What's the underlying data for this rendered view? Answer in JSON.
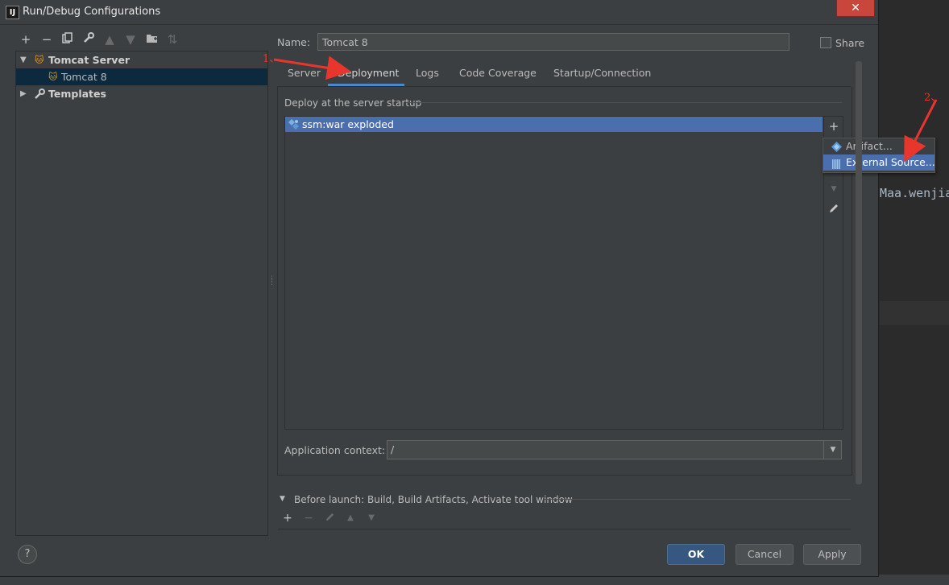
{
  "window": {
    "title": "Run/Debug Configurations",
    "app_icon": "IJ",
    "close_glyph": "✕"
  },
  "background": {
    "code_text": "Maa.wenjia"
  },
  "left_toolbar": {
    "icons": [
      "add-icon",
      "remove-icon",
      "copy-icon",
      "wrench-icon",
      "move-up-icon",
      "move-down-icon",
      "folder-icon",
      "sort-icon"
    ]
  },
  "tree": {
    "items": [
      {
        "label": "Tomcat Server",
        "level": 0,
        "expanded": true
      },
      {
        "label": "Tomcat 8",
        "level": 1,
        "selected": true
      },
      {
        "label": "Templates",
        "level": 0,
        "expanded": false
      }
    ]
  },
  "config": {
    "name_label": "Name:",
    "name_value": "Tomcat 8",
    "share_label": "Share",
    "share_checked": false
  },
  "tabs": [
    {
      "label": "Server"
    },
    {
      "label": "Deployment",
      "active": true
    },
    {
      "label": "Logs"
    },
    {
      "label": "Code Coverage"
    },
    {
      "label": "Startup/Connection"
    }
  ],
  "deployment": {
    "section_title": "Deploy at the server startup",
    "items": [
      "ssm:war exploded"
    ],
    "add_button": "+",
    "popup_items": [
      {
        "label": "Artifact..."
      },
      {
        "label": "External Source...",
        "selected": true
      }
    ],
    "context_label": "Application context:",
    "context_value": "/"
  },
  "before_launch": {
    "label": "Before launch: Build, Build Artifacts, Activate tool window"
  },
  "buttons": {
    "help": "?",
    "ok": "OK",
    "cancel": "Cancel",
    "apply": "Apply"
  },
  "annotations": {
    "step1": "1、",
    "step2": "2、",
    "color": "#e8362d"
  }
}
